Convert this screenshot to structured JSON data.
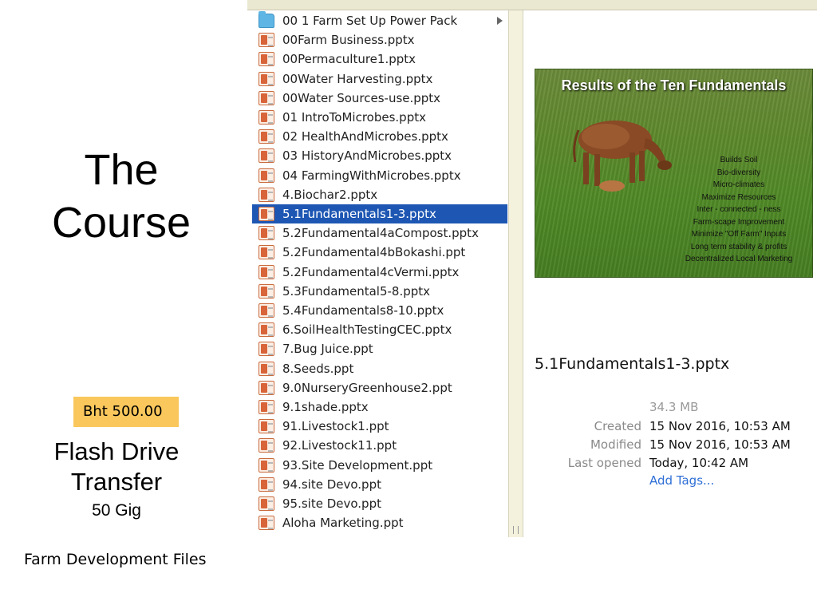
{
  "slide": {
    "course_title_line1": "The",
    "course_title_line2": "Course",
    "price": "Bht 500.00",
    "flash_line1": "Flash Drive",
    "flash_line2": "Transfer",
    "flash_size": "50 Gig",
    "footer": "Farm Development Files"
  },
  "finder": {
    "files": [
      {
        "name": "00 1 Farm Set Up Power Pack",
        "icon": "folder-icon",
        "has_arrow": true
      },
      {
        "name": "00Farm Business.pptx",
        "icon": "ppt-icon"
      },
      {
        "name": "00Permaculture1.pptx",
        "icon": "ppt-icon"
      },
      {
        "name": "00Water Harvesting.pptx",
        "icon": "ppt-icon"
      },
      {
        "name": "00Water Sources-use.pptx",
        "icon": "ppt-icon"
      },
      {
        "name": "01 IntroToMicrobes.pptx",
        "icon": "ppt-icon"
      },
      {
        "name": "02 HealthAndMicrobes.pptx",
        "icon": "ppt-icon"
      },
      {
        "name": "03 HistoryAndMicrobes.pptx",
        "icon": "ppt-icon"
      },
      {
        "name": "04 FarmingWithMicrobes.pptx",
        "icon": "ppt-icon"
      },
      {
        "name": "4.Biochar2.pptx",
        "icon": "ppt-icon"
      },
      {
        "name": "5.1Fundamentals1-3.pptx",
        "icon": "ppt-icon",
        "selected": true
      },
      {
        "name": "5.2Fundamental4aCompost.pptx",
        "icon": "ppt-icon"
      },
      {
        "name": "5.2Fundamental4bBokashi.ppt",
        "icon": "ppt-icon"
      },
      {
        "name": "5.2Fundamental4cVermi.pptx",
        "icon": "ppt-icon"
      },
      {
        "name": "5.3Fundamental5-8.pptx",
        "icon": "ppt-icon"
      },
      {
        "name": "5.4Fundamentals8-10.pptx",
        "icon": "ppt-icon"
      },
      {
        "name": "6.SoilHealthTestingCEC.pptx",
        "icon": "ppt-icon"
      },
      {
        "name": "7.Bug Juice.ppt",
        "icon": "ppt-icon"
      },
      {
        "name": "8.Seeds.ppt",
        "icon": "ppt-icon"
      },
      {
        "name": "9.0NurseryGreenhouse2.ppt",
        "icon": "ppt-icon"
      },
      {
        "name": "9.1shade.pptx",
        "icon": "ppt-icon"
      },
      {
        "name": "91.Livestock1.ppt",
        "icon": "ppt-icon"
      },
      {
        "name": "92.Livestock11.ppt",
        "icon": "ppt-icon"
      },
      {
        "name": "93.Site Development.ppt",
        "icon": "ppt-icon"
      },
      {
        "name": "94.site Devo.ppt",
        "icon": "ppt-icon"
      },
      {
        "name": "95.site Devo.ppt",
        "icon": "ppt-icon"
      },
      {
        "name": "Aloha Marketing.ppt",
        "icon": "ppt-icon"
      }
    ],
    "preview": {
      "thumbnail_title": "Results of the Ten Fundamentals",
      "thumbnail_bullets": [
        "Builds Soil",
        "Bio-diversity",
        "Micro-climates",
        "Maximize Resources",
        "Inter - connected - ness",
        "Farm-scape Improvement",
        "Minimize \"Off Farm\" Inputs",
        "Long term stability & profits",
        "Decentralized Local Marketing"
      ],
      "filename": "5.1Fundamentals1-3.pptx",
      "size": "34.3 MB",
      "created_label": "Created",
      "created_value": "15 Nov 2016, 10:53 AM",
      "modified_label": "Modified",
      "modified_value": "15 Nov 2016, 10:53 AM",
      "opened_label": "Last opened",
      "opened_value": "Today, 10:42 AM",
      "add_tags": "Add Tags..."
    },
    "colors": {
      "selection": "#1e57b3",
      "link": "#2f6fd6",
      "price_tag": "#f9c75c"
    }
  }
}
